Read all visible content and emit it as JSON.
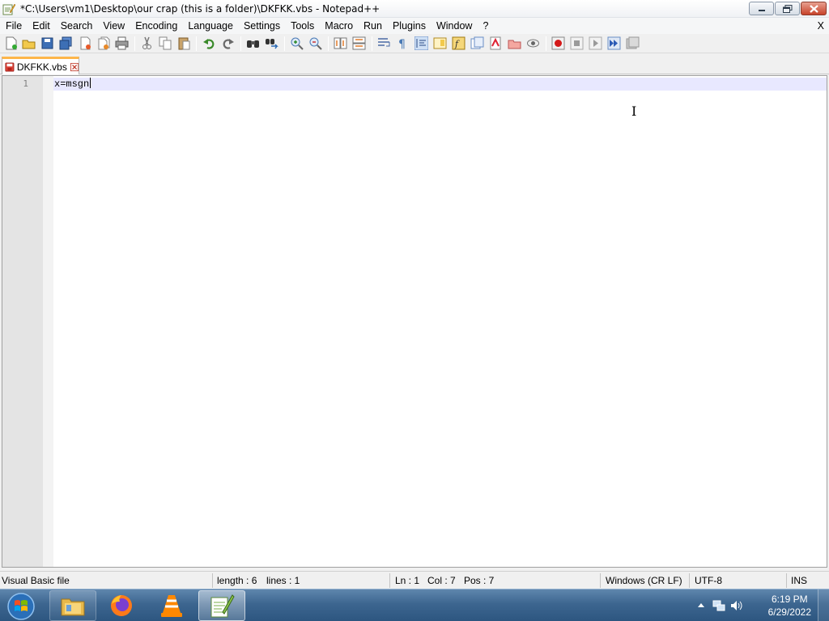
{
  "window": {
    "title": "*C:\\Users\\vm1\\Desktop\\our crap (this is a folder)\\DKFKK.vbs - Notepad++"
  },
  "menu": {
    "items": [
      "File",
      "Edit",
      "Search",
      "View",
      "Encoding",
      "Language",
      "Settings",
      "Tools",
      "Macro",
      "Run",
      "Plugins",
      "Window",
      "?"
    ],
    "close_label": "X"
  },
  "toolbar": {
    "icons": [
      "new-file-icon",
      "open-file-icon",
      "save-icon",
      "save-all-icon",
      "close-file-icon",
      "close-all-icon",
      "print-icon",
      "cut-icon",
      "copy-icon",
      "paste-icon",
      "undo-icon",
      "redo-icon",
      "find-icon",
      "replace-icon",
      "zoom-in-icon",
      "zoom-out-icon",
      "sync-vertical-icon",
      "sync-horizontal-icon",
      "word-wrap-icon",
      "show-all-chars-icon",
      "indent-guide-icon",
      "document-map-icon",
      "function-list-icon",
      "folder-as-workspace-icon",
      "monitoring-icon",
      "user-language-icon",
      "browser-preview-icon",
      "record-macro-icon",
      "stop-record-icon",
      "play-macro-icon",
      "run-macro-multiple-icon",
      "save-macro-icon"
    ]
  },
  "tab": {
    "label": "DKFKK.vbs"
  },
  "editor": {
    "line_number": "1",
    "code": "x=msgn"
  },
  "status": {
    "language": "Visual Basic file",
    "length": "length : 6",
    "lines": "lines : 1",
    "ln": "Ln : 1",
    "col": "Col : 7",
    "pos": "Pos : 7",
    "eol": "Windows (CR LF)",
    "encoding": "UTF-8",
    "mode": "INS"
  },
  "taskbar": {
    "apps": [
      "windows-explorer-icon",
      "firefox-icon",
      "vlc-icon",
      "notepadpp-icon"
    ],
    "time": "6:19 PM",
    "date": "6/29/2022"
  },
  "colors": {
    "tab_accent": "#fdb64a",
    "current_line": "#e8e8ff",
    "gutter": "#e4e4e4",
    "taskbar": "#3d6690"
  }
}
